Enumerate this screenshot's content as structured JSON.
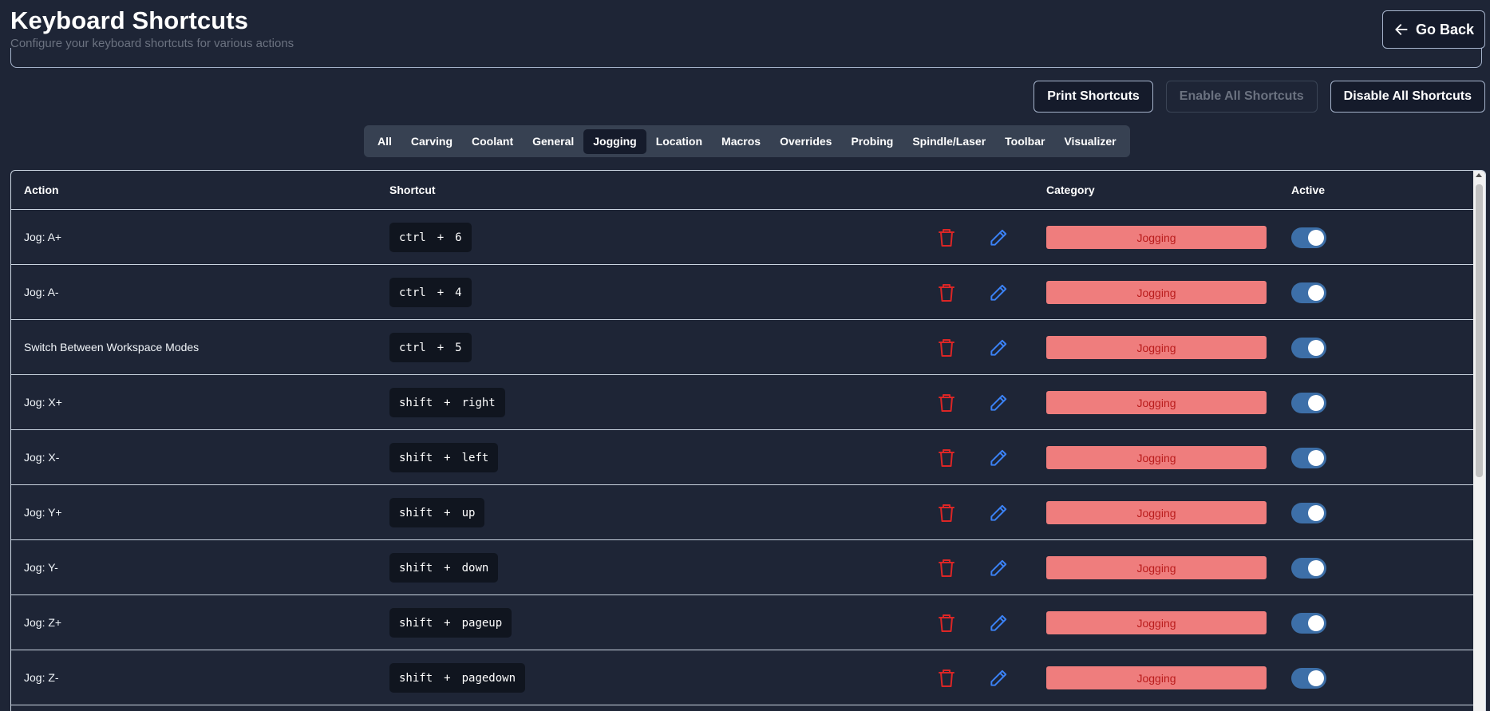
{
  "header": {
    "title": "Keyboard Shortcuts",
    "subtitle": "Configure your keyboard shortcuts for various actions",
    "back_label": "Go Back"
  },
  "actions": {
    "print": "Print Shortcuts",
    "enable_all": "Enable All Shortcuts",
    "disable_all": "Disable All Shortcuts"
  },
  "tabs": [
    {
      "label": "All",
      "active": false
    },
    {
      "label": "Carving",
      "active": false
    },
    {
      "label": "Coolant",
      "active": false
    },
    {
      "label": "General",
      "active": false
    },
    {
      "label": "Jogging",
      "active": true
    },
    {
      "label": "Location",
      "active": false
    },
    {
      "label": "Macros",
      "active": false
    },
    {
      "label": "Overrides",
      "active": false
    },
    {
      "label": "Probing",
      "active": false
    },
    {
      "label": "Spindle/Laser",
      "active": false
    },
    {
      "label": "Toolbar",
      "active": false
    },
    {
      "label": "Visualizer",
      "active": false
    }
  ],
  "table": {
    "columns": {
      "action": "Action",
      "shortcut": "Shortcut",
      "category": "Category",
      "active": "Active"
    },
    "rows": [
      {
        "action": "Jog: A+",
        "keys": [
          "ctrl",
          "+",
          "6"
        ],
        "category": "Jogging",
        "active": true
      },
      {
        "action": "Jog: A-",
        "keys": [
          "ctrl",
          "+",
          "4"
        ],
        "category": "Jogging",
        "active": true
      },
      {
        "action": "Switch Between Workspace Modes",
        "keys": [
          "ctrl",
          "+",
          "5"
        ],
        "category": "Jogging",
        "active": true
      },
      {
        "action": "Jog: X+",
        "keys": [
          "shift",
          "+",
          "right"
        ],
        "category": "Jogging",
        "active": true
      },
      {
        "action": "Jog: X-",
        "keys": [
          "shift",
          "+",
          "left"
        ],
        "category": "Jogging",
        "active": true
      },
      {
        "action": "Jog: Y+",
        "keys": [
          "shift",
          "+",
          "up"
        ],
        "category": "Jogging",
        "active": true
      },
      {
        "action": "Jog: Y-",
        "keys": [
          "shift",
          "+",
          "down"
        ],
        "category": "Jogging",
        "active": true
      },
      {
        "action": "Jog: Z+",
        "keys": [
          "shift",
          "+",
          "pageup"
        ],
        "category": "Jogging",
        "active": true
      },
      {
        "action": "Jog: Z-",
        "keys": [
          "shift",
          "+",
          "pagedown"
        ],
        "category": "Jogging",
        "active": true
      }
    ]
  },
  "colors": {
    "background": "#1e2536",
    "category_badge": "#ef7d7d",
    "category_text": "#b91c1c",
    "toggle_on": "#3d6fa8",
    "delete_icon": "#dc2626",
    "edit_icon": "#3b82f6"
  }
}
